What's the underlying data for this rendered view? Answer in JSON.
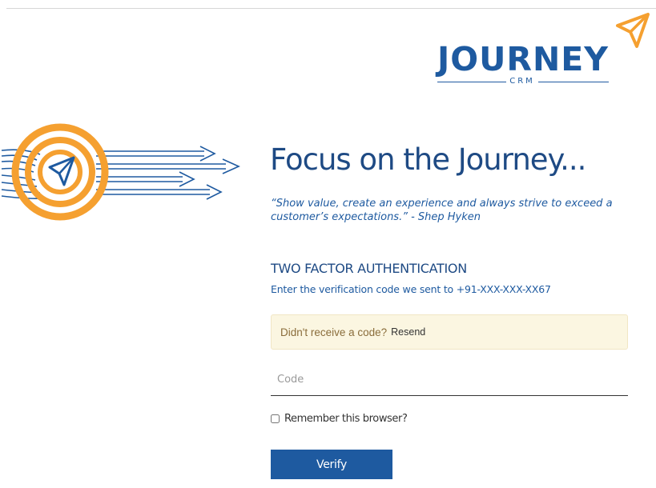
{
  "logo": {
    "wordmark": "JOURNEY",
    "subtitle": "CRM",
    "icon": "paper-plane-icon"
  },
  "illustration": {
    "icon": "target-paper-plane-icon"
  },
  "hero": {
    "headline": "Focus on the Journey...",
    "quote": "“Show value, create an experience and always strive to exceed a customer’s expectations.” - Shep Hyken"
  },
  "auth": {
    "title": "TWO FACTOR AUTHENTICATION",
    "description": "Enter the verification code we sent to +91-XXX-XXX-XX67",
    "alert_text": "Didn't receive a code?",
    "resend_label": "Resend",
    "code_placeholder": "Code",
    "code_value": "",
    "remember_label": "Remember this browser?",
    "remember_checked": false,
    "verify_label": "Verify"
  },
  "colors": {
    "brand_blue": "#1e5aa0",
    "brand_orange": "#f5a030",
    "alert_bg": "#fbf6e1"
  }
}
